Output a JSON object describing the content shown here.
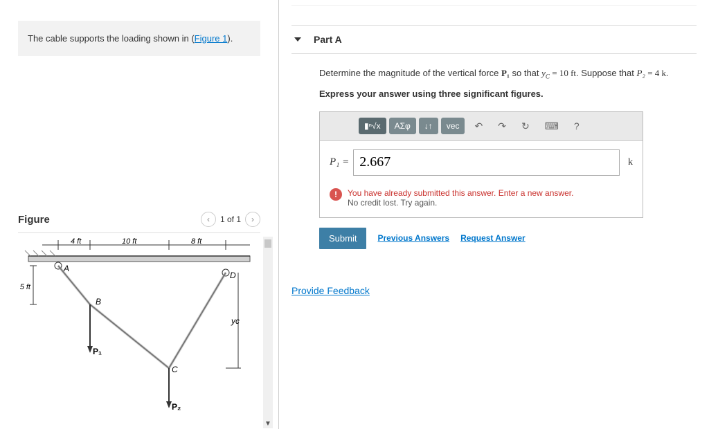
{
  "left": {
    "problem_prefix": "The cable supports the loading shown in (",
    "figure_link": "Figure 1",
    "problem_suffix": ").",
    "figure_title": "Figure",
    "pager": "1 of 1",
    "diagram": {
      "dim_4ft": "4 ft",
      "dim_10ft": "10 ft",
      "dim_8ft": "8 ft",
      "dim_5ft": "5 ft",
      "ptA": "A",
      "ptB": "B",
      "ptC": "C",
      "ptD": "D",
      "p1": "P₁",
      "p2": "P₂",
      "yc": "yc"
    }
  },
  "part": {
    "title": "Part A",
    "question_pre": "Determine the magnitude of the vertical force ",
    "p1": "P₁",
    "question_mid1": " so that ",
    "yc": "y",
    "yc_sub": "C",
    "eq1": " = 10 ft",
    "question_mid2": ". Suppose that ",
    "p2": "P₂",
    "eq2": " = 4 k.",
    "instruct": "Express your answer using three significant figures.",
    "toolbar": {
      "sqrt": "ⁿ√x",
      "greek": "ΑΣφ",
      "updn": "↓↑",
      "vec": "vec",
      "undo": "↶",
      "redo": "↷",
      "reset": "↻",
      "keyb": "⌨",
      "help": "?"
    },
    "input_label": "P₁ =",
    "input_value": "2.667",
    "unit": "k",
    "feedback_line1": "You have already submitted this answer. Enter a new answer.",
    "feedback_line2": "No credit lost. Try again.",
    "submit": "Submit",
    "prev_answers": "Previous Answers",
    "request_answer": "Request Answer"
  },
  "provide_feedback": "Provide Feedback"
}
